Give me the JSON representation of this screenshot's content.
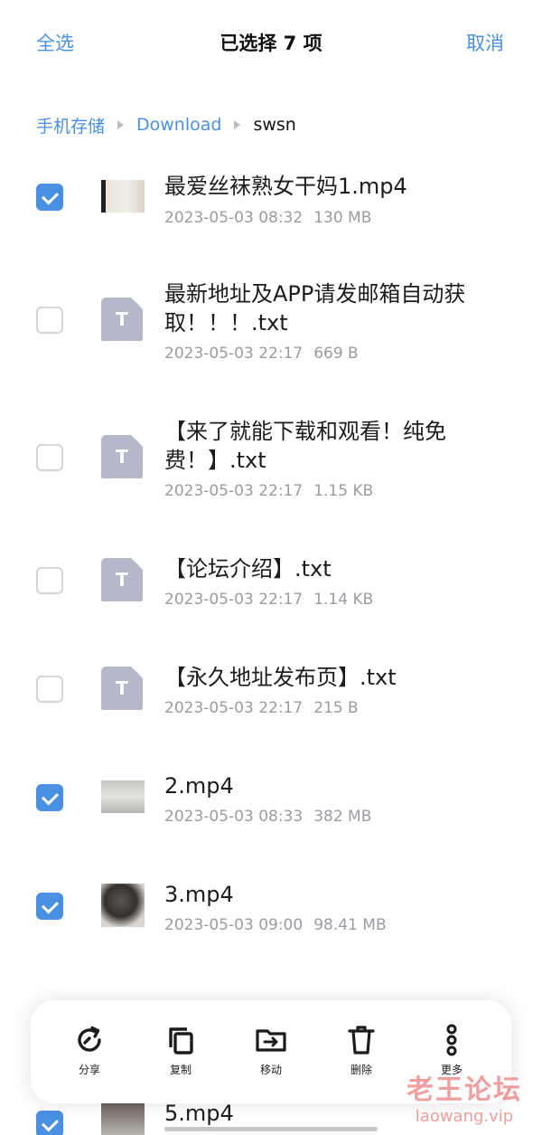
{
  "header": {
    "select_all": "全选",
    "title": "已选择 7 项",
    "cancel": "取消"
  },
  "breadcrumb": [
    "手机存储",
    "Download",
    "swsn"
  ],
  "files": [
    {
      "name": "最爱丝袜熟女干妈1.mp4",
      "date": "2023-05-03 08:32",
      "size": "130 MB",
      "type": "video",
      "checked": true
    },
    {
      "name": "最新地址及APP请发邮箱自动获取！！！.txt",
      "date": "2023-05-03 22:17",
      "size": "669 B",
      "type": "txt",
      "checked": false
    },
    {
      "name": "【来了就能下载和观看！纯免费！】.txt",
      "date": "2023-05-03 22:17",
      "size": "1.15 KB",
      "type": "txt",
      "checked": false
    },
    {
      "name": "【论坛介绍】.txt",
      "date": "2023-05-03 22:17",
      "size": "1.14 KB",
      "type": "txt",
      "checked": false
    },
    {
      "name": "【永久地址发布页】.txt",
      "date": "2023-05-03 22:17",
      "size": "215 B",
      "type": "txt",
      "checked": false
    },
    {
      "name": "2.mp4",
      "date": "2023-05-03 08:33",
      "size": "382 MB",
      "type": "video",
      "checked": true
    },
    {
      "name": "3.mp4",
      "date": "2023-05-03 09:00",
      "size": "98.41 MB",
      "type": "video",
      "checked": true
    },
    {
      "name": "5.mp4",
      "date": "",
      "size": "",
      "type": "video",
      "checked": true
    }
  ],
  "file_icon_letter": "T",
  "actions": [
    {
      "label": "分享",
      "icon": "share-icon"
    },
    {
      "label": "复制",
      "icon": "copy-icon"
    },
    {
      "label": "移动",
      "icon": "move-folder-icon"
    },
    {
      "label": "删除",
      "icon": "trash-icon"
    },
    {
      "label": "更多",
      "icon": "more-icon"
    }
  ],
  "watermark": {
    "cn": "老王论坛",
    "en": "laowang.vip"
  },
  "colors": {
    "accent": "#4a90e2",
    "text": "#1c1c1e",
    "meta": "#9a9ca2",
    "file_icon": "#b4b8c8"
  }
}
